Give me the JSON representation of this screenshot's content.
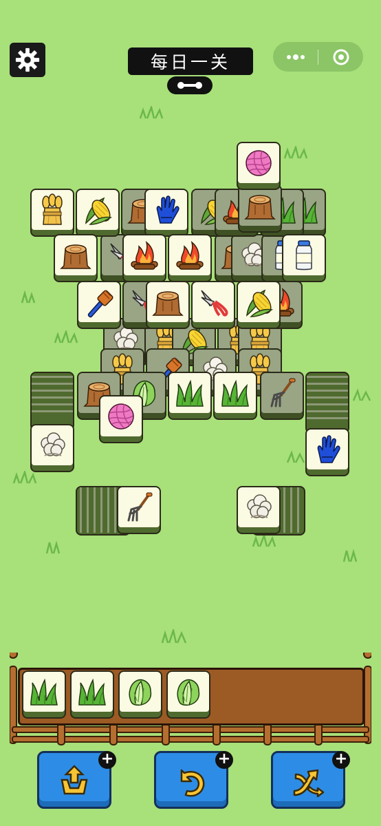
{
  "header": {
    "title": "每日一关"
  },
  "icons": {
    "settings": "gear-icon",
    "link": "link-icon",
    "menu": "more-dots-icon",
    "close": "target-close-icon"
  },
  "board": {
    "tiles_visible": [
      "wheat",
      "corn",
      "stump",
      "blue-glove",
      "yarn",
      "campfire",
      "campfire",
      "milk-bottle",
      "blue-brush",
      "stump",
      "pruning-shears",
      "corn",
      "grass",
      "grass",
      "stump",
      "yarn",
      "napa-cabbage",
      "cauliflower",
      "blue-glove",
      "pitchfork",
      "cauliflower"
    ]
  },
  "tray": {
    "capacity": 7,
    "slots": [
      "grass",
      "grass",
      "napa-cabbage",
      "napa-cabbage"
    ]
  },
  "tools": [
    {
      "name": "pop-out",
      "icon": "pop-out-icon",
      "plus": "+"
    },
    {
      "name": "undo",
      "icon": "undo-icon",
      "plus": "+"
    },
    {
      "name": "shuffle",
      "icon": "shuffle-icon",
      "plus": "+"
    }
  ],
  "colors": {
    "background": "#a8e07a",
    "tile_face": "#fbfae3",
    "tile_side": "#4f6a2e",
    "button_blue": "#2d8de6",
    "fence": "#b46e30"
  }
}
